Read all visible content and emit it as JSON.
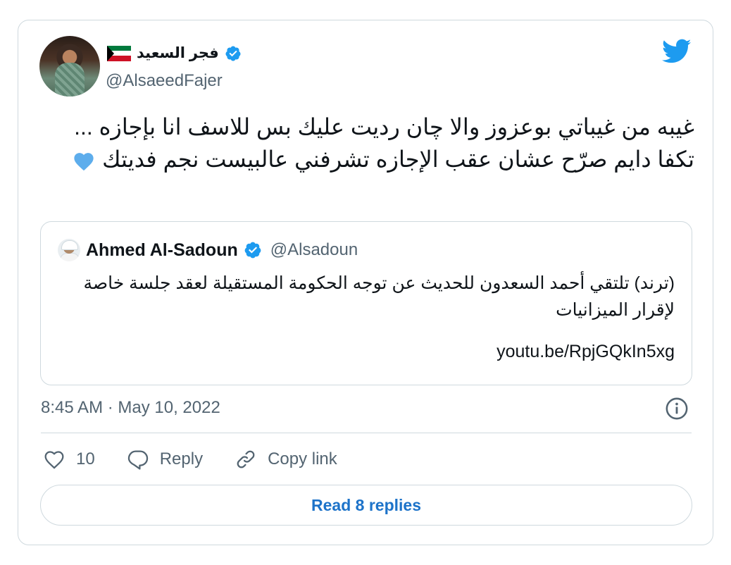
{
  "tweet": {
    "author": {
      "display_name": "فجر السعيد",
      "handle": "@AlsaeedFajer",
      "flag_icon": "kuwait-flag-icon",
      "verified": true
    },
    "text": "غيبه من غيباتي بوعزوز والا چان رديت عليك بس للاسف انا بإجازه ... تكفا دايم صرّح عشان عقب الإجازه تشرفني عالبيست نجم فديتك",
    "emoji": "💙",
    "timestamp": "8:45 AM · May 10, 2022",
    "likes": "10",
    "reply_label": "Reply",
    "copy_link_label": "Copy link",
    "read_replies_label": "Read 8 replies"
  },
  "quoted_tweet": {
    "display_name": "Ahmed Al-Sadoun",
    "handle": "@Alsadoun",
    "verified": true,
    "text": "(ترند) تلتقي أحمد السعدون للحديث عن  توجه الحكومة المستقيلة لعقد جلسة خاصة لإقرار الميزانيات",
    "link": "youtu.be/RpjGQkIn5xg"
  },
  "colors": {
    "twitter_blue": "#1d9bf0",
    "link_blue": "#1d73c9",
    "border": "#cfd9de",
    "secondary_text": "#536471",
    "heart_emoji": "#5dadec"
  }
}
